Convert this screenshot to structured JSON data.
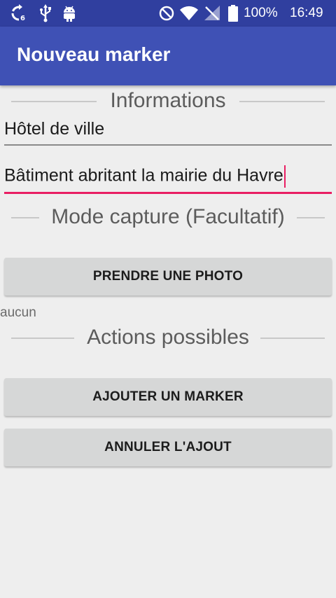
{
  "status_bar": {
    "battery_percent": "100%",
    "time": "16:49",
    "left_icons": [
      "sync-icon",
      "usb-icon",
      "android-icon"
    ],
    "right_icons": [
      "do-not-disturb-icon",
      "wifi-icon",
      "no-sim-icon",
      "battery-icon"
    ]
  },
  "app_bar": {
    "title": "Nouveau marker"
  },
  "sections": {
    "informations": "Informations",
    "capture": "Mode capture (Facultatif)",
    "actions": "Actions possibles"
  },
  "fields": {
    "name": {
      "value": "Hôtel de ville"
    },
    "description": {
      "value": "Bâtiment abritant la mairie du Havre"
    }
  },
  "buttons": {
    "take_photo": "PRENDRE UNE PHOTO",
    "add_marker": "AJOUTER UN MARKER",
    "cancel_add": "ANNULER L'AJOUT"
  },
  "photo_status": "aucun",
  "colors": {
    "status_bar": "#303f9f",
    "app_bar": "#3f51b5",
    "accent": "#e91e63",
    "background": "#eeeeee",
    "button": "#d6d7d7"
  }
}
